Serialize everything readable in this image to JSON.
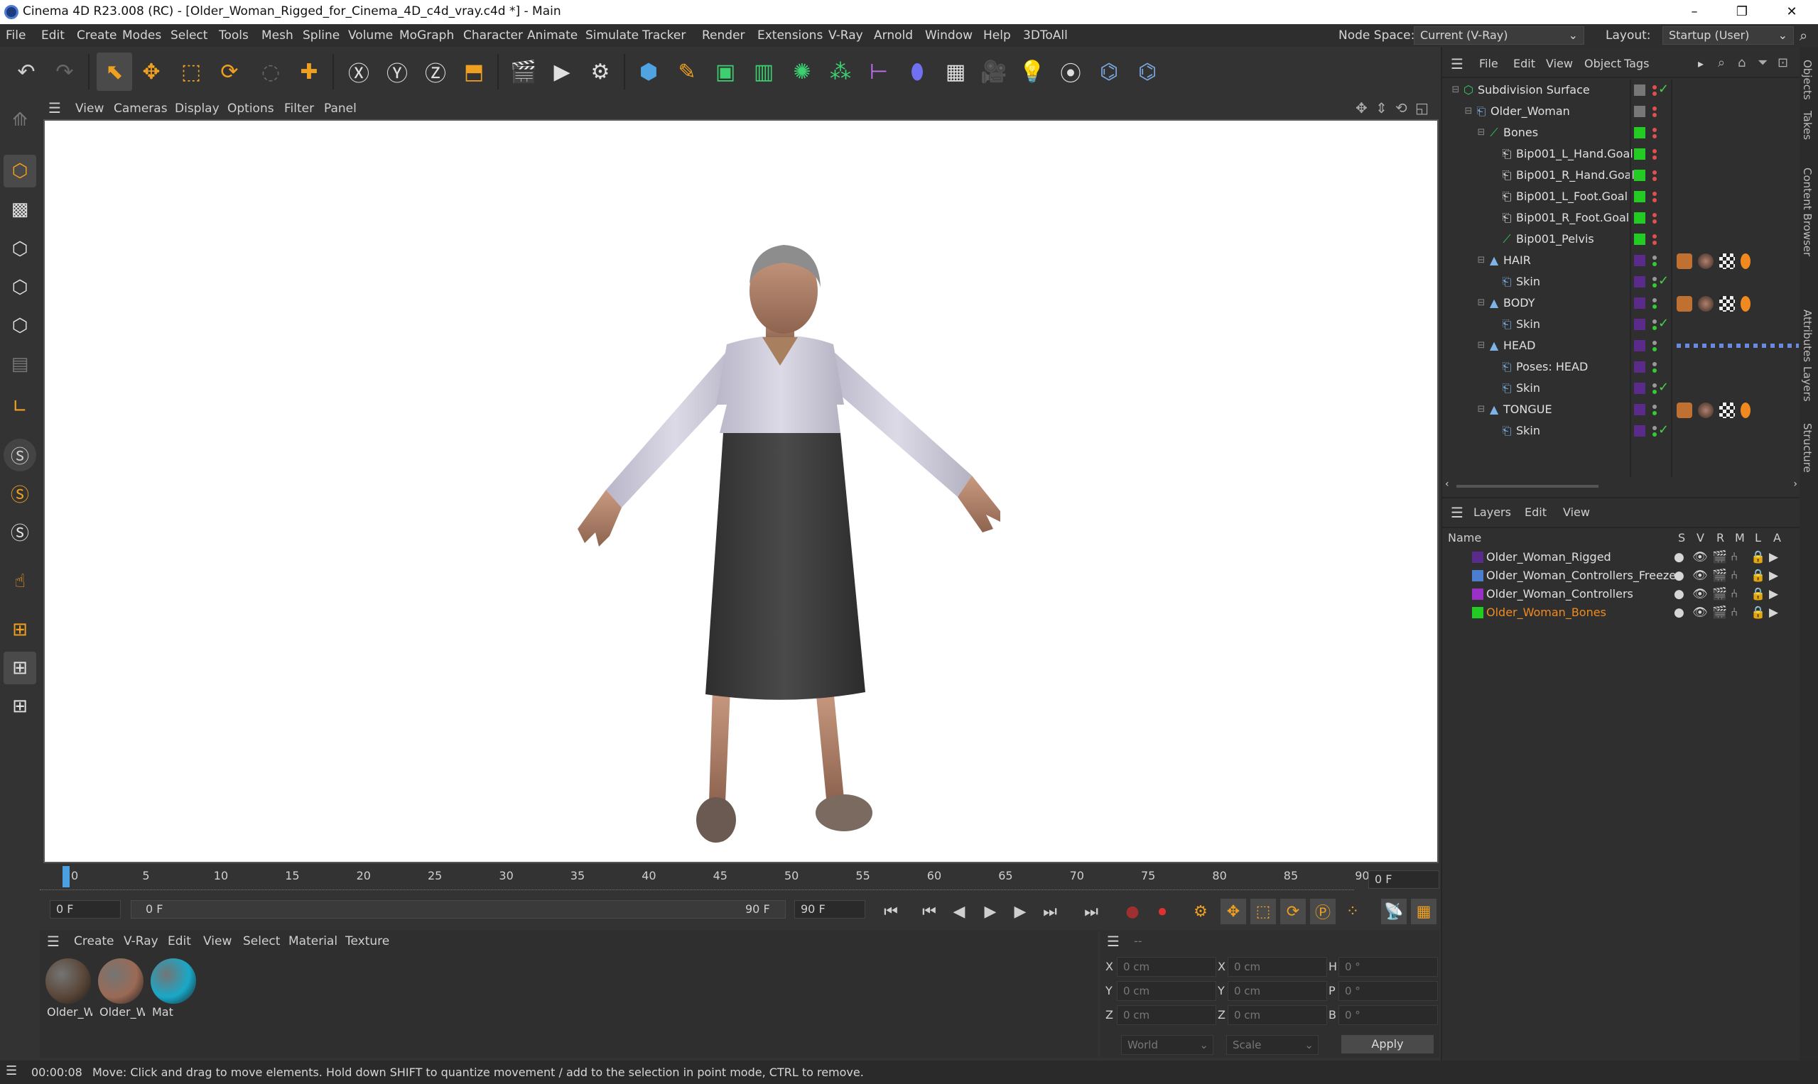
{
  "window": {
    "title": "Cinema 4D R23.008 (RC) - [Older_Woman_Rigged_for_Cinema_4D_c4d_vray.c4d *] - Main",
    "minimize": "–",
    "maximize": "❐",
    "close": "✕"
  },
  "menubar": {
    "items": [
      "File",
      "Edit",
      "Create",
      "Modes",
      "Select",
      "Tools",
      "Mesh",
      "Spline",
      "Volume",
      "MoGraph",
      "Character",
      "Animate",
      "Simulate",
      "Tracker",
      "Render",
      "Extensions",
      "V-Ray",
      "Arnold",
      "Window",
      "Help",
      "3DToAll"
    ],
    "node_space_label": "Node Space:",
    "node_space_value": "Current (V-Ray)",
    "layout_label": "Layout:",
    "layout_value": "Startup (User)"
  },
  "viewport": {
    "menu": [
      "View",
      "Cameras",
      "Display",
      "Options",
      "Filter",
      "Panel"
    ]
  },
  "timeline": {
    "ticks": [
      "0",
      "5",
      "10",
      "15",
      "20",
      "25",
      "30",
      "35",
      "40",
      "45",
      "50",
      "55",
      "60",
      "65",
      "70",
      "75",
      "80",
      "85",
      "90"
    ],
    "current_frame": "0 F",
    "start_field": "0 F",
    "range_start": "0 F",
    "range_end": "90 F",
    "end_field": "90 F"
  },
  "material_manager": {
    "menu": [
      "Create",
      "V-Ray",
      "Edit",
      "View",
      "Select",
      "Material",
      "Texture"
    ],
    "materials": [
      {
        "label": "Older_W",
        "color": "#5a4638"
      },
      {
        "label": "Older_W",
        "color": "#9a6a55"
      },
      {
        "label": "Mat",
        "color": "#19a8c8"
      }
    ]
  },
  "coordinates": {
    "header": "--",
    "rows": [
      {
        "a": "X",
        "a_val": "0 cm",
        "b": "X",
        "b_val": "0 cm",
        "c": "H",
        "c_val": "0 °"
      },
      {
        "a": "Y",
        "a_val": "0 cm",
        "b": "Y",
        "b_val": "0 cm",
        "c": "P",
        "c_val": "0 °"
      },
      {
        "a": "Z",
        "a_val": "0 cm",
        "b": "Z",
        "b_val": "0 cm",
        "c": "B",
        "c_val": "0 °"
      }
    ],
    "world": "World",
    "scale": "Scale",
    "apply": "Apply"
  },
  "status": {
    "time": "00:00:08",
    "message": "Move: Click and drag to move elements. Hold down SHIFT to quantize movement / add to the selection in point mode, CTRL to remove."
  },
  "objects_panel": {
    "menu": [
      "File",
      "Edit",
      "View",
      "Object",
      "Tags"
    ],
    "tree": [
      {
        "name": "Subdivision Surface",
        "indent": 0,
        "color": "#33cc66",
        "tag": "check"
      },
      {
        "name": "Older_Woman",
        "indent": 1,
        "color": "#7fb2e5",
        "tag": "none"
      },
      {
        "name": "Bones",
        "indent": 2,
        "color": "#33cc66",
        "tag": "green"
      },
      {
        "name": "Bip001_L_Hand.Goal",
        "indent": 3,
        "color": "#e0e0e0",
        "tag": "green"
      },
      {
        "name": "Bip001_R_Hand.Goal",
        "indent": 3,
        "color": "#e0e0e0",
        "tag": "green"
      },
      {
        "name": "Bip001_L_Foot.Goal",
        "indent": 3,
        "color": "#e0e0e0",
        "tag": "green"
      },
      {
        "name": "Bip001_R_Foot.Goal",
        "indent": 3,
        "color": "#e0e0e0",
        "tag": "green"
      },
      {
        "name": "Bip001_Pelvis",
        "indent": 3,
        "color": "#33cc66",
        "tag": "green"
      },
      {
        "name": "HAIR",
        "indent": 2,
        "color": "#7fb2e5",
        "tag": "mats"
      },
      {
        "name": "Skin",
        "indent": 3,
        "color": "#7fb2e5",
        "tag": "check"
      },
      {
        "name": "BODY",
        "indent": 2,
        "color": "#7fb2e5",
        "tag": "mats"
      },
      {
        "name": "Skin",
        "indent": 3,
        "color": "#7fb2e5",
        "tag": "check"
      },
      {
        "name": "HEAD",
        "indent": 2,
        "color": "#7fb2e5",
        "tag": "dots"
      },
      {
        "name": "Poses: HEAD",
        "indent": 3,
        "color": "#7fb2e5",
        "tag": "none"
      },
      {
        "name": "Skin",
        "indent": 3,
        "color": "#7fb2e5",
        "tag": "check"
      },
      {
        "name": "TONGUE",
        "indent": 2,
        "color": "#7fb2e5",
        "tag": "mats"
      },
      {
        "name": "Skin",
        "indent": 3,
        "color": "#7fb2e5",
        "tag": "check"
      }
    ]
  },
  "layers_panel": {
    "menu": [
      "Layers",
      "Edit",
      "View"
    ],
    "name_header": "Name",
    "col_headers": [
      "S",
      "V",
      "R",
      "M",
      "L",
      "A"
    ],
    "layers": [
      {
        "name": "Older_Woman_Rigged",
        "color": "#5a2b8a",
        "active": false
      },
      {
        "name": "Older_Woman_Controllers_Freeze",
        "color": "#4a7fd0",
        "active": false
      },
      {
        "name": "Older_Woman_Controllers",
        "color": "#9a30c8",
        "active": false
      },
      {
        "name": "Older_Woman_Bones",
        "color": "#22cc22",
        "active": true
      }
    ]
  },
  "side_tabs": [
    "Objects",
    "Takes",
    "Content Browser",
    "Attributes",
    "Layers",
    "Structure"
  ]
}
